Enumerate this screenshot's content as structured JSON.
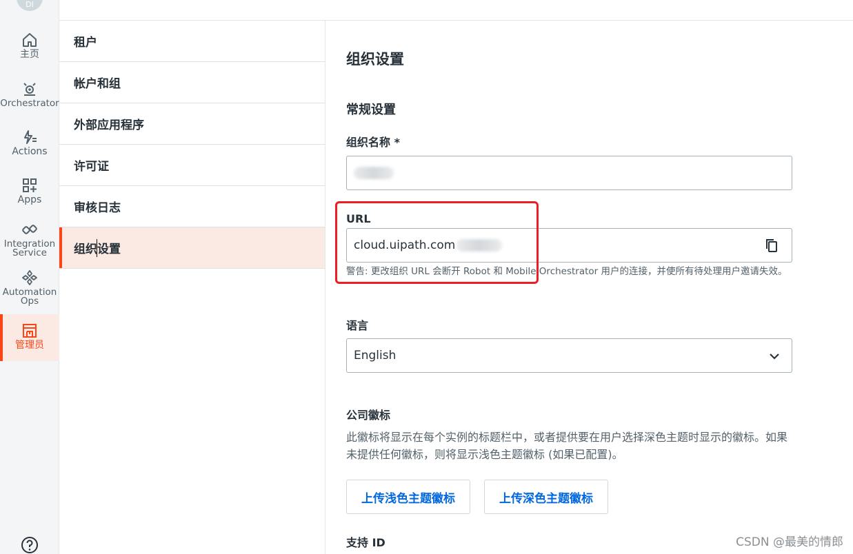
{
  "rail": {
    "avatar_text": "DI",
    "items": [
      {
        "label": "主页",
        "icon": "home-icon"
      },
      {
        "label": "Orchestrator",
        "icon": "orchestrator-icon"
      },
      {
        "label": "Actions",
        "icon": "actions-icon"
      },
      {
        "label": "Apps",
        "icon": "apps-icon"
      },
      {
        "label": "Integration",
        "label2": "Service",
        "icon": "integration-icon"
      },
      {
        "label": "Automation",
        "label2": "Ops",
        "icon": "automation-ops-icon"
      },
      {
        "label": "管理员",
        "icon": "admin-icon",
        "active": true
      }
    ],
    "help_icon": "help-icon"
  },
  "subnav": {
    "items": [
      {
        "label": "租户"
      },
      {
        "label": "帐户和组"
      },
      {
        "label": "外部应用程序"
      },
      {
        "label": "许可证"
      },
      {
        "label": "审核日志"
      },
      {
        "label": "组织设置",
        "active": true
      }
    ]
  },
  "main": {
    "title": "组织设置",
    "general_title": "常规设置",
    "org_name_label": "组织名称 *",
    "url_label": "URL",
    "url_value": "cloud.uipath.com",
    "url_warning": "警告: 更改组织 URL 会断开 Robot 和 Mobile Orchestrator 用户的连接，并使所有待处理用户邀请失效。",
    "language_label": "语言",
    "language_value": "English",
    "logo_title": "公司徽标",
    "logo_desc": "此徽标将显示在每个实例的标题栏中，或者提供要在用户选择深色主题时显示的徽标。如果未提供任何徽标，则将显示浅色主题徽标 (如果已配置)。",
    "upload_light_label": "上传浅色主题徽标",
    "upload_dark_label": "上传深色主题徽标",
    "support_id_label": "支持 ID"
  },
  "watermark": "CSDN @最美的情郎",
  "colors": {
    "accent": "#fa4616",
    "link": "#0067df",
    "annotation": "#ee1c25"
  }
}
